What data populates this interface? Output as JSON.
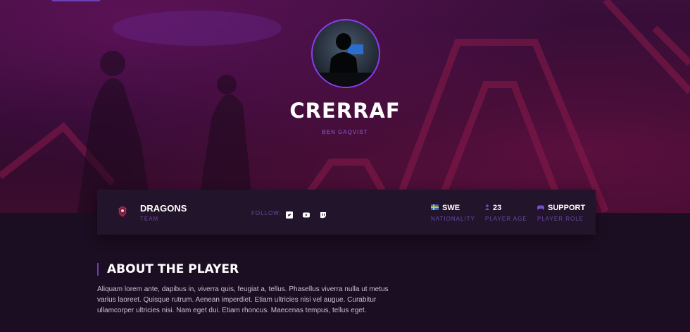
{
  "player": {
    "handle": "CRERRAF",
    "real_name": "BEN GAQVIST"
  },
  "team": {
    "name": "DRAGONS",
    "label": "TEAM"
  },
  "follow": {
    "label": "FOLLOW:",
    "networks": [
      "twitter-icon",
      "youtube-icon",
      "twitch-icon"
    ]
  },
  "stats": [
    {
      "value": "SWE",
      "label": "NATIONALITY",
      "icon": "sweden-flag-icon"
    },
    {
      "value": "23",
      "label": "PLAYER AGE",
      "icon": "person-icon"
    },
    {
      "value": "SUPPORT",
      "label": "PLAYER ROLE",
      "icon": "gamepad-icon"
    }
  ],
  "about": {
    "title": "ABOUT THE PLAYER",
    "body": "Aliquam lorem ante, dapibus in, viverra quis, feugiat a, tellus. Phasellus viverra nulla ut metus varius laoreet. Quisque rutrum. Aenean imperdiet. Etiam ultricies nisi vel augue. Curabitur ullamcorper ultricies nisi. Nam eget dui. Etiam rhoncus. Maecenas tempus, tellus eget."
  },
  "colors": {
    "accent": "#6d3fb3",
    "label": "#6a4aa8",
    "background": "#1c0e22",
    "panel": "#22142a"
  }
}
